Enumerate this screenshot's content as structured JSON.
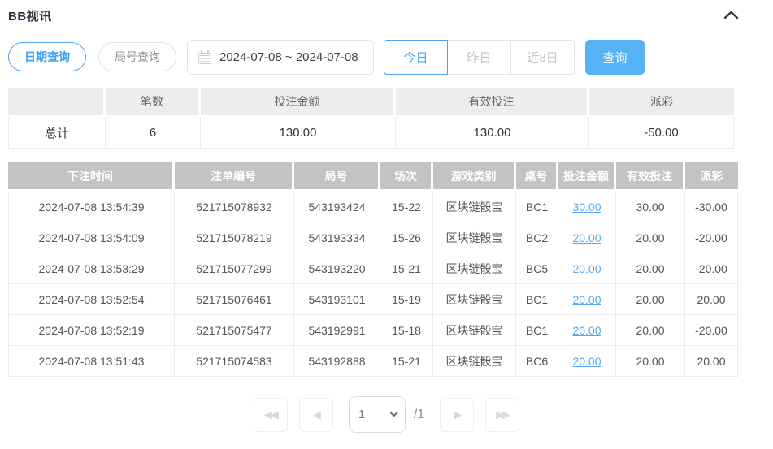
{
  "colors": {
    "accent_blue": "#4ba4f1",
    "button_blue": "#58b2f6",
    "link_blue": "#55aaf3",
    "negative_red": "#f0545f",
    "table_header_gray": "#c3c3c3",
    "summary_header_gray": "#ededed"
  },
  "header": {
    "title": "BB视讯",
    "collapse_icon": "chevron-up-icon"
  },
  "filters": {
    "date_query_label": "日期查询",
    "round_query_label": "局号查询",
    "calendar_icon": "calendar-icon",
    "date_range_value": "2024-07-08 ~ 2024-07-08",
    "quick_buttons": [
      {
        "key": "today",
        "label": "今日",
        "active": true
      },
      {
        "key": "yesterday",
        "label": "昨日",
        "active": false
      },
      {
        "key": "last-8-days",
        "label": "近8日",
        "active": false
      }
    ],
    "query_label": "查询"
  },
  "summary_table": {
    "columns": [
      "",
      "笔数",
      "投注金额",
      "有效投注",
      "派彩"
    ],
    "row": {
      "label": "总计",
      "count": "6",
      "bet_amount": "130.00",
      "valid_bet": "130.00",
      "payout": "-50.00"
    }
  },
  "records_table": {
    "columns": [
      "下注时间",
      "注单编号",
      "局号",
      "场次",
      "游戏类别",
      "桌号",
      "投注金额",
      "有效投注",
      "派彩"
    ],
    "rows": [
      [
        "2024-07-08 13:54:39",
        "521715078932",
        "543193424",
        "15-22",
        "区块链骰宝",
        "BC1",
        "30.00",
        "30.00",
        "-30.00"
      ],
      [
        "2024-07-08 13:54:09",
        "521715078219",
        "543193334",
        "15-26",
        "区块链骰宝",
        "BC2",
        "20.00",
        "20.00",
        "-20.00"
      ],
      [
        "2024-07-08 13:53:29",
        "521715077299",
        "543193220",
        "15-21",
        "区块链骰宝",
        "BC5",
        "20.00",
        "20.00",
        "-20.00"
      ],
      [
        "2024-07-08 13:52:54",
        "521715076461",
        "543193101",
        "15-19",
        "区块链骰宝",
        "BC1",
        "20.00",
        "20.00",
        "20.00"
      ],
      [
        "2024-07-08 13:52:19",
        "521715075477",
        "543192991",
        "15-18",
        "区块链骰宝",
        "BC1",
        "20.00",
        "20.00",
        "-20.00"
      ],
      [
        "2024-07-08 13:51:43",
        "521715074583",
        "543192888",
        "15-21",
        "区块链骰宝",
        "BC6",
        "20.00",
        "20.00",
        "20.00"
      ]
    ]
  },
  "pagination": {
    "icons": {
      "first": "◀◀",
      "prev": "◀",
      "next": "▶",
      "last": "▶▶"
    },
    "page_value": "1",
    "total_label": "/1"
  }
}
